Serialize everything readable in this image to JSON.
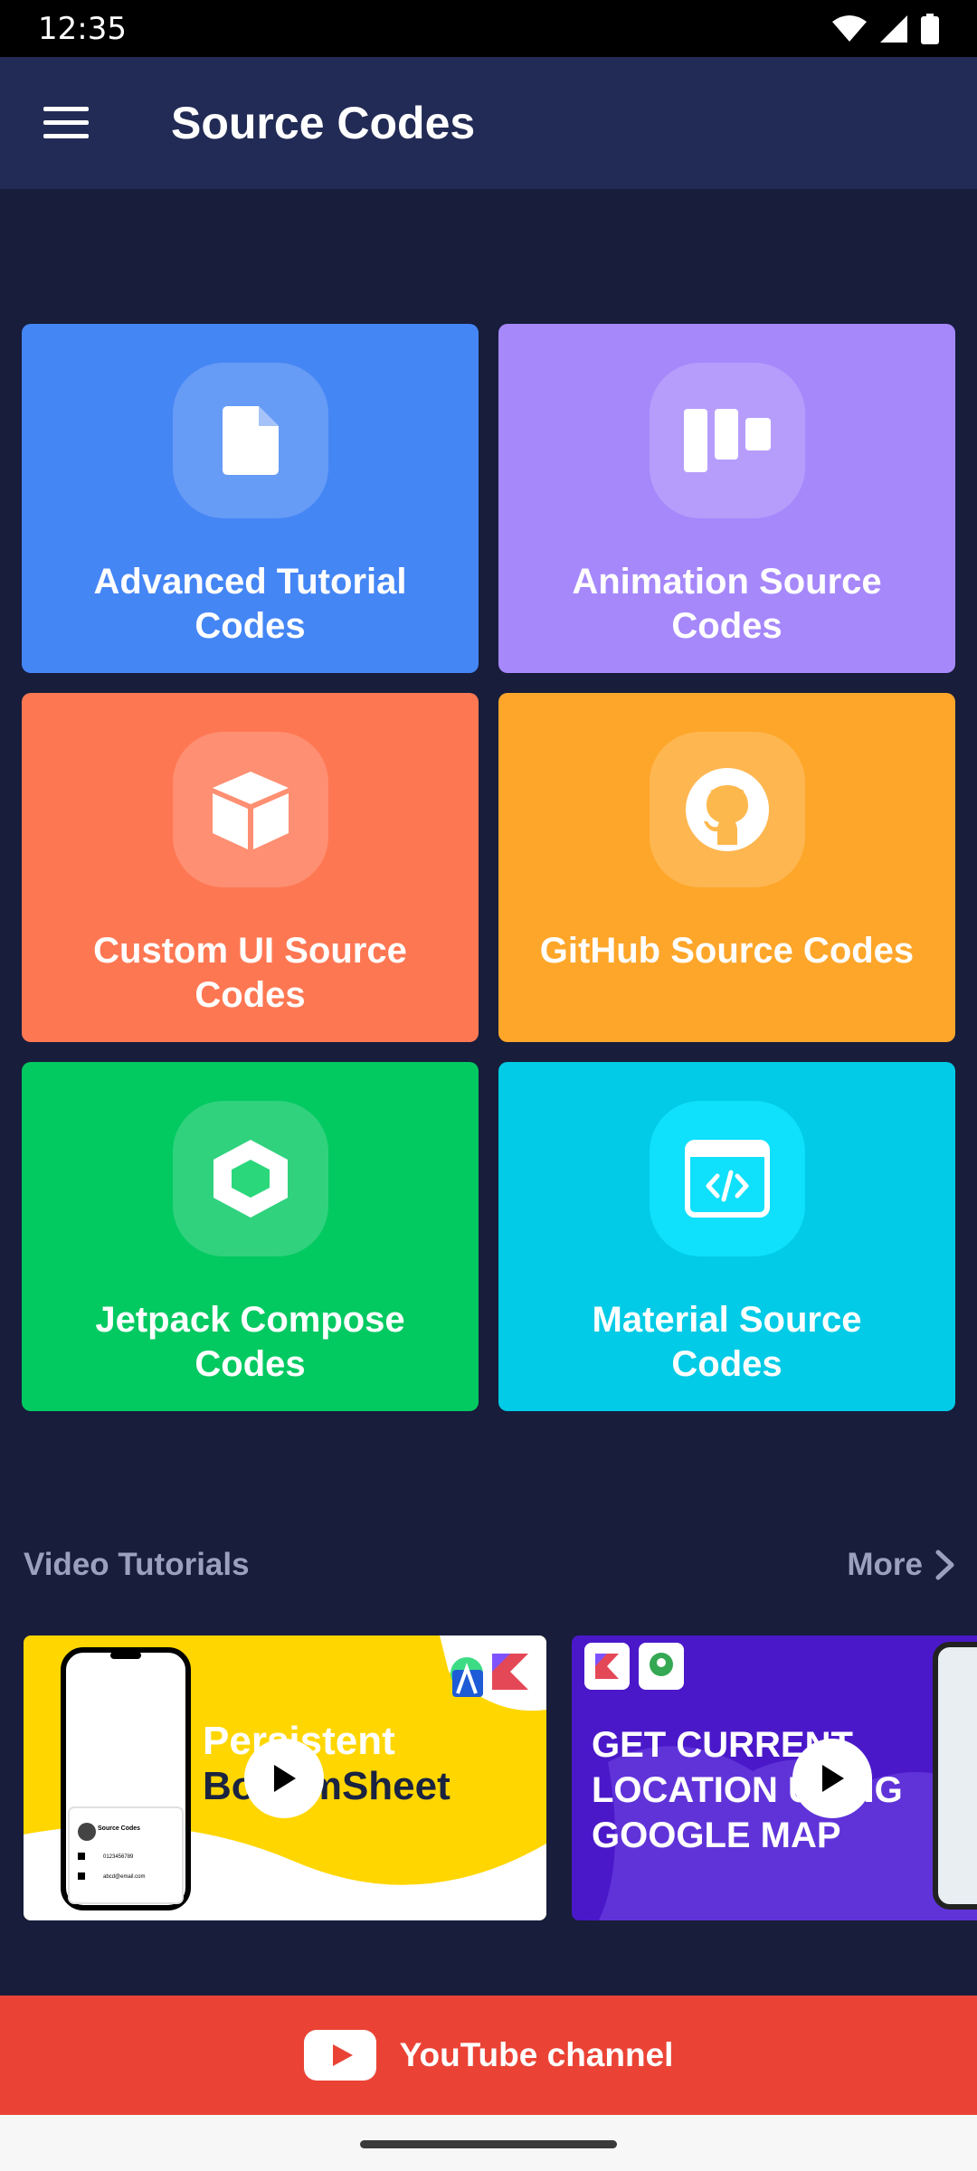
{
  "status_bar": {
    "time": "12:35"
  },
  "app_bar": {
    "title": "Source Codes"
  },
  "tiles": [
    {
      "label": "Advanced Tutorial Codes",
      "color": "#4586f5",
      "icon": "file-icon"
    },
    {
      "label": "Animation Source Codes",
      "color": "#a688fb",
      "icon": "kanban-icon"
    },
    {
      "label": "Custom UI Source Codes",
      "color": "#fe7753",
      "icon": "cube-icon"
    },
    {
      "label": "GitHub Source Codes",
      "color": "#fea62a",
      "icon": "github-icon"
    },
    {
      "label": "Jetpack Compose Codes",
      "color": "#03c961",
      "icon": "hexagon-icon"
    },
    {
      "label": "Material Source Codes",
      "color": "#01cbe6",
      "icon": "code-window-icon"
    }
  ],
  "videos": {
    "title": "Video Tutorials",
    "more_label": "More",
    "items": [
      {
        "line1": "Persistent",
        "line2": "BottomSheet",
        "phone_name": "Source Codes",
        "phone_number": "0123456789",
        "phone_email": "abcd@email.com"
      },
      {
        "text": "GET CURRENT LOCATION USING GOOGLE MAP"
      }
    ]
  },
  "youtube": {
    "label": "YouTube channel"
  }
}
